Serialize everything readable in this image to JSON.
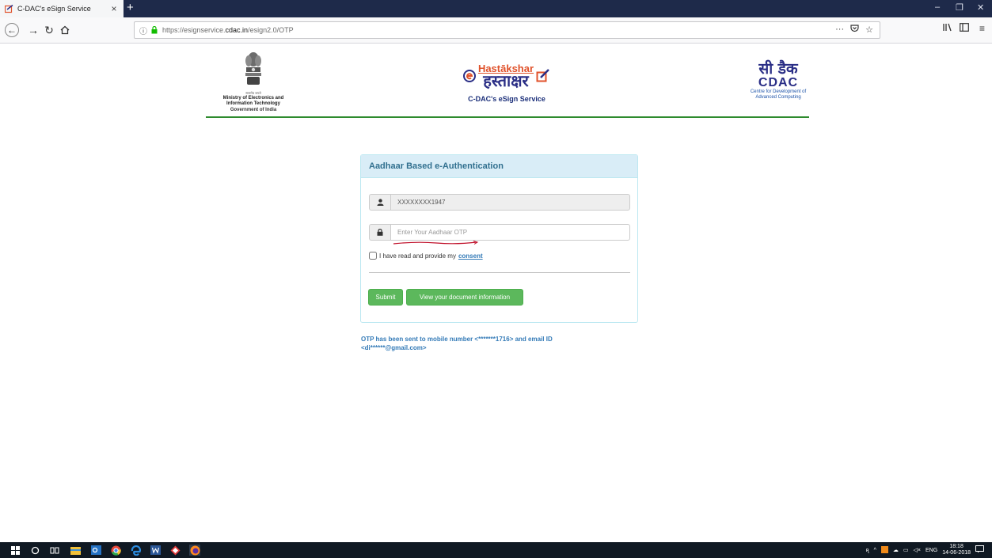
{
  "browser": {
    "tab_title": "C-DAC's eSign Service",
    "tab_close": "×",
    "new_tab": "+",
    "url_scheme": "https://esignservice.",
    "url_host": "cdac.in",
    "url_path": "/esign2.0/OTP",
    "page_actions": "···",
    "minimize": "–",
    "maximize": "❐",
    "close": "✕"
  },
  "header": {
    "moe_tagline": "सत्यमेव जयते",
    "moe_line1": "Ministry of Electronics and",
    "moe_line2": "Information Technology",
    "moe_line3": "Government of India",
    "hastakshar_eng": "Hastākshar",
    "hastakshar_hin": "हस्ताक्षर",
    "service_name": "C-DAC's eSign Service",
    "cdac_hin": "सी डैक",
    "cdac_eng": "CDAC",
    "cdac_line1": "Centre for Development of",
    "cdac_line2": "Advanced Computing"
  },
  "form": {
    "panel_title": "Aadhaar Based e-Authentication",
    "aadhaar_value": "XXXXXXXX1947",
    "otp_placeholder": "Enter Your Aadhaar OTP",
    "consent_text": "I have read and provide my",
    "consent_link": "consent",
    "submit_label": "Submit",
    "view_doc_label": "View your document information"
  },
  "otp_message": {
    "line1": "OTP has been sent to mobile number <*******1716> and email ID",
    "line2": "<di******@gmail.com>"
  },
  "taskbar": {
    "lang": "ENG",
    "time": "18:18",
    "date": "14-06-2018"
  },
  "colors": {
    "panel_header_bg": "#d9edf7",
    "panel_header_text": "#31708f",
    "button_green": "#5cb85c",
    "link_blue": "#337ab7",
    "header_rule": "#2e8b2e"
  }
}
